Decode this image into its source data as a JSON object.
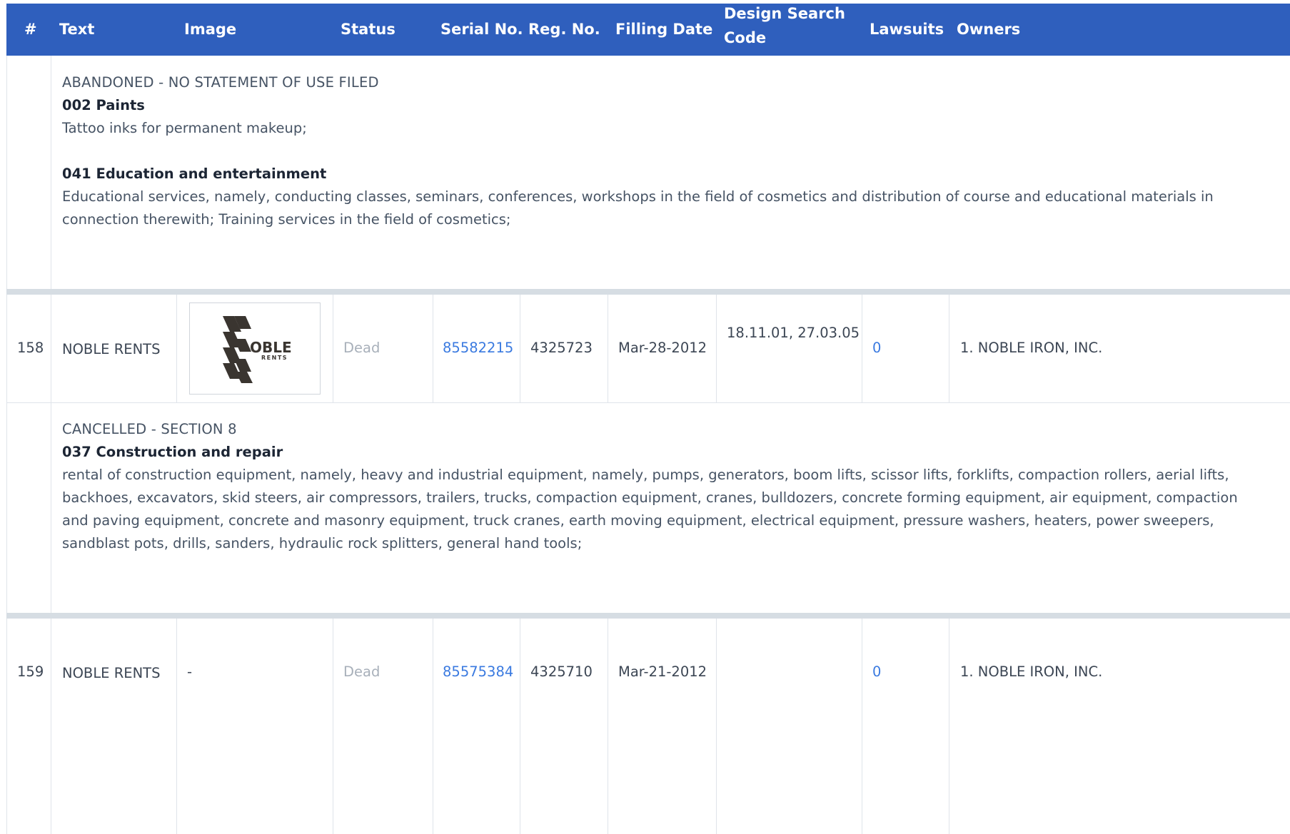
{
  "header": {
    "num": "#",
    "text": "Text",
    "image": "Image",
    "status": "Status",
    "serial": "Serial No.",
    "reg": "Reg. No.",
    "filing": "Filling Date",
    "design_line1": "Design Search",
    "design_line2": "Code",
    "lawsuits": "Lawsuits",
    "owners": "Owners"
  },
  "detail_prev": {
    "status_text": "ABANDONED - NO STATEMENT OF USE FILED",
    "classes": [
      {
        "title": "002 Paints",
        "desc": "Tattoo inks for permanent makeup;"
      },
      {
        "title": "041 Education and entertainment",
        "desc_line1": "Educational services, namely, conducting classes, seminars, conferences, workshops in the field of cosmetics and distribution of course and educational materials in",
        "desc_line2": "connection therewith; Training services in the field of cosmetics;"
      }
    ]
  },
  "rows": [
    {
      "num": "158",
      "text": "NOBLE RENTS",
      "image_logo_text": "OBLE",
      "image_logo_sub": "RENTS",
      "status": "Dead",
      "serial": "85582215",
      "reg": "4325723",
      "filing": "Mar-28-2012",
      "design_codes": "18.11.01, 27.03.05",
      "lawsuits": "0",
      "owners": "1. NOBLE IRON, INC."
    },
    {
      "num": "159",
      "text": "NOBLE RENTS",
      "image": "-",
      "status": "Dead",
      "serial": "85575384",
      "reg": "4325710",
      "filing": "Mar-21-2012",
      "design_codes": "",
      "lawsuits": "0",
      "owners": "1. NOBLE IRON, INC."
    }
  ],
  "detail_158": {
    "status_text": "CANCELLED - SECTION 8",
    "class_title": "037 Construction and repair",
    "desc_lines": [
      "rental of construction equipment, namely, heavy and industrial equipment, namely, pumps, generators, boom lifts, scissor lifts, forklifts, compaction rollers, aerial lifts,",
      "backhoes, excavators, skid steers, air compressors, trailers, trucks, compaction equipment, cranes, bulldozers, concrete forming equipment, air equipment, compaction",
      "and paving equipment, concrete and masonry equipment, truck cranes, earth moving equipment, electrical equipment, pressure washers, heaters, power sweepers,",
      "sandblast pots, drills, sanders, hydraulic rock splitters, general hand tools;"
    ]
  },
  "colors": {
    "header_bg": "#2f5fbd",
    "link": "#3a7ae0",
    "dead": "#a8b0ba",
    "separator": "#d6dde3"
  }
}
